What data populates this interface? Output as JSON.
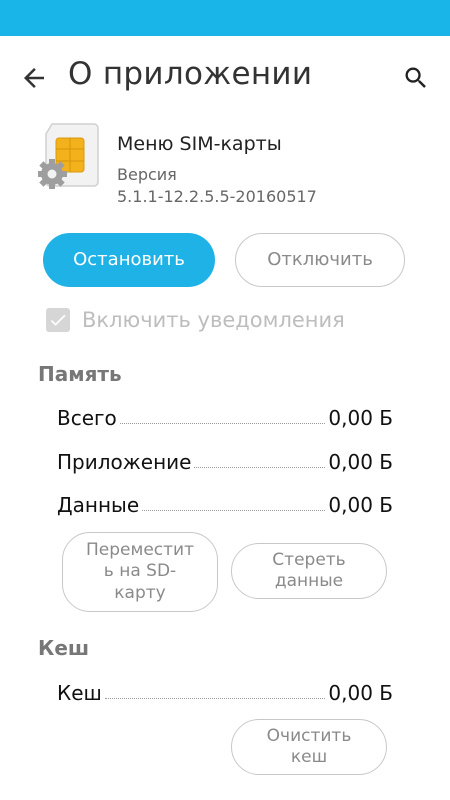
{
  "header": {
    "title": "О приложении",
    "back_icon": "arrow-back-icon",
    "search_icon": "search-icon"
  },
  "app": {
    "icon": "sim-card-gear-icon",
    "name": "Меню SIM-карты",
    "version_label": "Версия",
    "version_value": "5.1.1-12.2.5.5-20160517"
  },
  "actions": {
    "stop_label": "Остановить",
    "disable_label": "Отключить"
  },
  "notifications": {
    "label": "Включить уведомления",
    "checked": true,
    "enabled": false
  },
  "storage": {
    "header": "Память",
    "rows": [
      {
        "label": "Всего",
        "value": "0,00 Б"
      },
      {
        "label": "Приложение",
        "value": "0,00 Б"
      },
      {
        "label": "Данные",
        "value": "0,00 Б"
      }
    ],
    "move_label": "Переместит\nь на SD-\nкарту",
    "clear_data_label": "Стереть\nданные"
  },
  "cache": {
    "header": "Кеш",
    "rows": [
      {
        "label": "Кеш",
        "value": "0,00 Б"
      }
    ],
    "clear_cache_label": "Очистить\nкеш"
  },
  "colors": {
    "status_bar": "#19b5e8",
    "accent": "#1fb2e6",
    "outline": "#c8c8c8",
    "disabled_text": "#bdbdbd"
  }
}
